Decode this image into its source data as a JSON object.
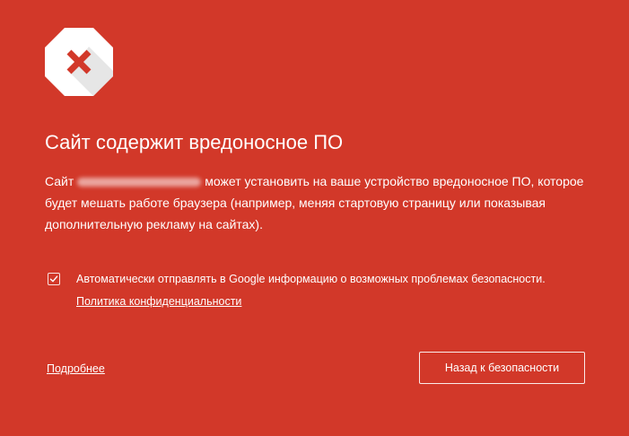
{
  "page": {
    "background_color": "#d23829"
  },
  "icon": {
    "name": "malware-octagon-x-icon",
    "shape_color": "#ffffff",
    "shadow_color": "#e7e7e7",
    "cross_color": "#d23829"
  },
  "heading": {
    "title": "Сайт содержит вредоносное ПО"
  },
  "body": {
    "prefix": "Сайт",
    "host_obscured": true,
    "rest": "может установить на ваше устройство вредоносное ПО, которое будет мешать работе браузера (например, меняя стартовую страницу или показывая дополнительную рекламу на сайтах)."
  },
  "optin": {
    "checked": true,
    "label": "Автоматически отправлять в Google информацию о возможных проблемах безопасности.",
    "privacy_link": "Политика конфиденциальности"
  },
  "footer": {
    "details_link": "Подробнее",
    "back_button": "Назад к безопасности"
  }
}
